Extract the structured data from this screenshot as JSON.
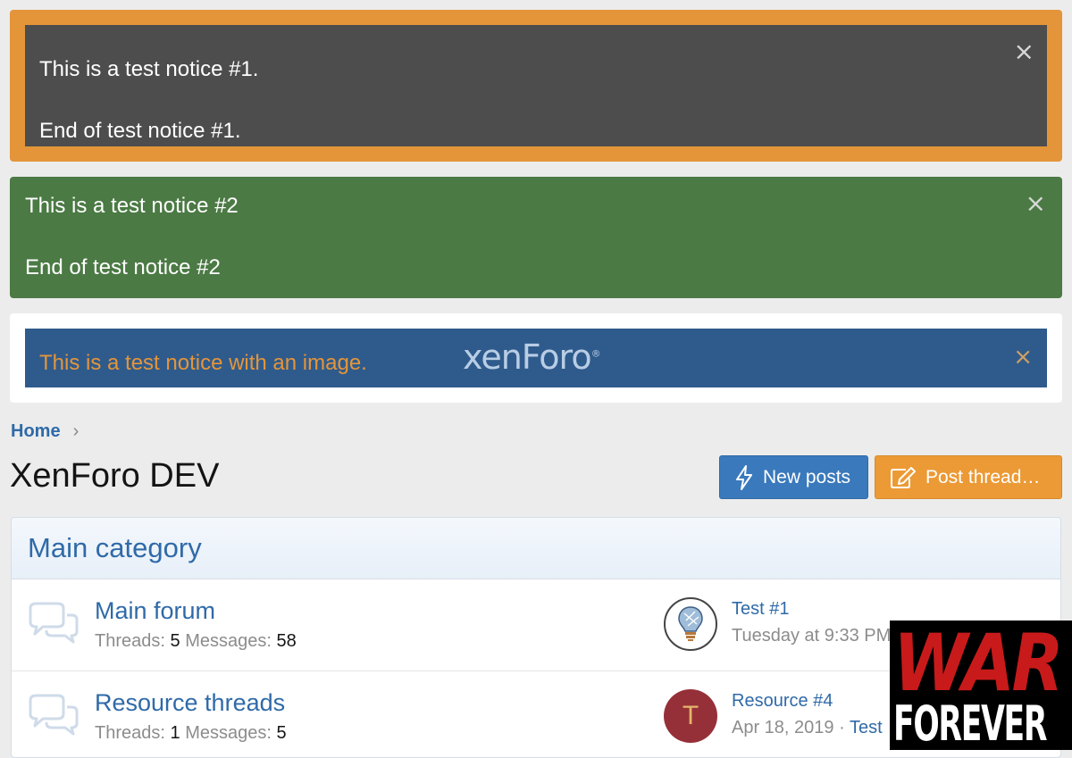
{
  "notices": [
    {
      "line1": "This is a test notice #1.",
      "line2": "End of test notice #1.",
      "close": "×"
    },
    {
      "line1": "This is a test notice #2",
      "line2": "End of test notice #2",
      "close": "×"
    },
    {
      "text": "This is a test notice with an image.",
      "logo_text": "xenForo",
      "logo_mark": "®",
      "close": "×"
    }
  ],
  "breadcrumb": {
    "home": "Home",
    "separator": "›"
  },
  "page": {
    "title": "XenForo DEV"
  },
  "buttons": {
    "new_posts": "New posts",
    "post_thread": "Post thread…"
  },
  "category": {
    "title": "Main category",
    "nodes": [
      {
        "title": "Main forum",
        "threads_label": "Threads:",
        "threads": "5",
        "messages_label": "Messages:",
        "messages": "58",
        "latest_title": "Test #1",
        "latest_meta": "Tuesday at 9:33 PM"
      },
      {
        "title": "Resource threads",
        "threads_label": "Threads:",
        "threads": "1",
        "messages_label": "Messages:",
        "messages": "5",
        "avatar_letter": "T",
        "latest_title": "Resource #4",
        "latest_date": "Apr 18, 2019",
        "latest_sep": "·",
        "latest_user": "Test"
      }
    ]
  },
  "overlay": {
    "line1": "WAR",
    "line2": "FOREVER"
  },
  "colors": {
    "notice1_border": "#e4953a",
    "notice1_bg": "#4d4d4d",
    "notice2_bg": "#4b7a44",
    "notice3_bg": "#2f5b8c",
    "link": "#2f6aa8",
    "button_blue": "#3a79bc",
    "button_orange": "#ec9a35",
    "avatar_t_bg": "#963038"
  }
}
